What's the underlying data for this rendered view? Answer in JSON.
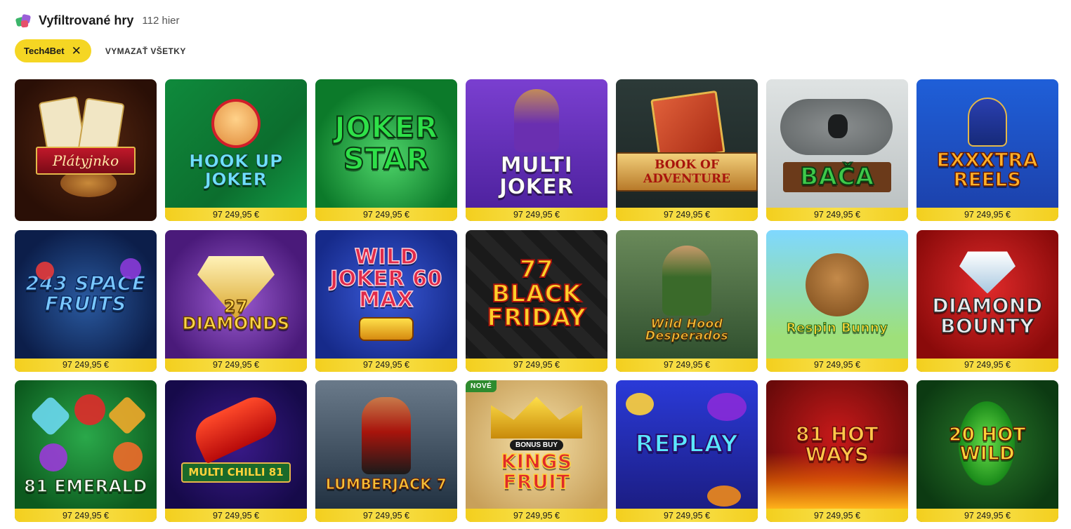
{
  "header": {
    "title": "Vyfiltrované hry",
    "count": "112 hier",
    "icon": "dice-icon"
  },
  "filters": {
    "active": [
      {
        "label": "Tech4Bet",
        "remove_icon": "close-icon"
      }
    ],
    "clear_all_label": "VYMAZAŤ VŠETKY"
  },
  "colors": {
    "accent": "#f5d623",
    "new_badge": "#2e8b2e"
  },
  "games": [
    {
      "name": "Plátyjnko",
      "jackpot": "",
      "badge": ""
    },
    {
      "name": "Hook Up Joker",
      "jackpot": "97 249,95  €",
      "badge": ""
    },
    {
      "name": "Joker Star",
      "jackpot": "97 249,95  €",
      "badge": ""
    },
    {
      "name": "Multi Joker",
      "jackpot": "97 249,95  €",
      "badge": ""
    },
    {
      "name": "Book of Adventure",
      "jackpot": "97 249,95  €",
      "badge": ""
    },
    {
      "name": "Bača",
      "jackpot": "97 249,95  €",
      "badge": ""
    },
    {
      "name": "Exxxtra Reels",
      "jackpot": "97 249,95  €",
      "badge": ""
    },
    {
      "name": "243 Space Fruits",
      "jackpot": "97 249,95  €",
      "badge": ""
    },
    {
      "name": "27 Diamonds",
      "jackpot": "97 249,95  €",
      "badge": ""
    },
    {
      "name": "Wild Joker 60 Max",
      "jackpot": "97 249,95  €",
      "badge": ""
    },
    {
      "name": "77 Black Friday",
      "jackpot": "97 249,95  €",
      "badge": ""
    },
    {
      "name": "Wild Hood Desperados",
      "jackpot": "97 249,95  €",
      "badge": ""
    },
    {
      "name": "Respin Bunny",
      "jackpot": "97 249,95  €",
      "badge": ""
    },
    {
      "name": "Diamond Bounty",
      "jackpot": "97 249,95  €",
      "badge": ""
    },
    {
      "name": "81 Emerald",
      "jackpot": "97 249,95  €",
      "badge": ""
    },
    {
      "name": "Multi Chilli 81",
      "jackpot": "97 249,95  €",
      "badge": ""
    },
    {
      "name": "Lumberjack 7",
      "jackpot": "97 249,95  €",
      "badge": ""
    },
    {
      "name": "Kings Fruit",
      "jackpot": "97 249,95  €",
      "badge": "NOVÉ",
      "subtitle": "BONUS BUY"
    },
    {
      "name": "Replay",
      "jackpot": "97 249,95  €",
      "badge": ""
    },
    {
      "name": "81 Hot Ways",
      "jackpot": "97 249,95  €",
      "badge": ""
    },
    {
      "name": "20 Hot Wild",
      "jackpot": "97 249,95  €",
      "badge": ""
    }
  ]
}
